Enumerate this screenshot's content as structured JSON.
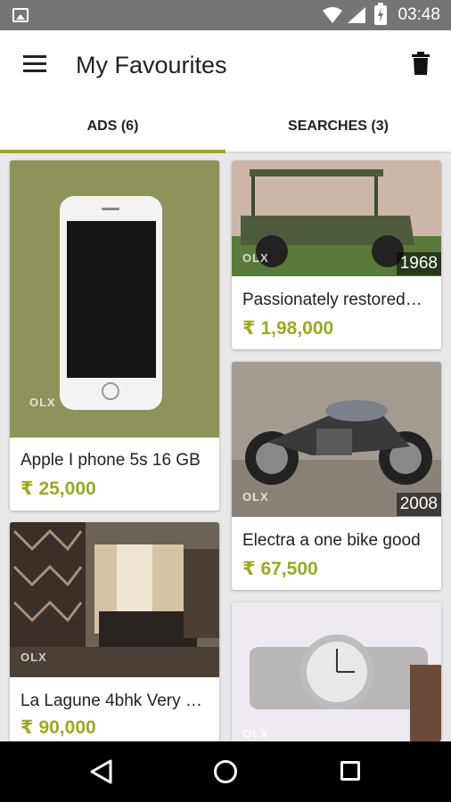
{
  "status_bar": {
    "time": "03:48"
  },
  "header": {
    "title": "My Favourites"
  },
  "tabs": [
    {
      "label": "ADS (6)",
      "active": true
    },
    {
      "label": "SEARCHES (3)",
      "active": false
    }
  ],
  "ads": [
    {
      "title": "Apple I phone 5s 16 GB",
      "price": "₹ 25,000",
      "photo": "white iPhone on fabric",
      "watermark": "OLX"
    },
    {
      "title": "Passionately restored…",
      "price": "₹ 1,98,000",
      "year": "1968",
      "photo": "green jeep",
      "watermark": "OLX"
    },
    {
      "title": "Electra a one bike good",
      "price": "₹ 67,500",
      "year": "2008",
      "photo": "motorcycle",
      "watermark": "OLX"
    },
    {
      "title": "La Lagune 4bhk Very L…",
      "price": "₹ 90,000",
      "photo": "apartment interior",
      "watermark": "OLX"
    },
    {
      "title": "",
      "price": "",
      "photo": "wrist watch",
      "watermark": "OLX"
    }
  ],
  "colors": {
    "accent": "#9aab1c",
    "status_bar": "#757575",
    "nav_bar": "#000000"
  },
  "icons": [
    "image-icon",
    "wifi-icon",
    "signal-icon",
    "battery-icon",
    "menu-icon",
    "trash-icon",
    "back-icon",
    "home-icon",
    "recent-apps-icon"
  ]
}
